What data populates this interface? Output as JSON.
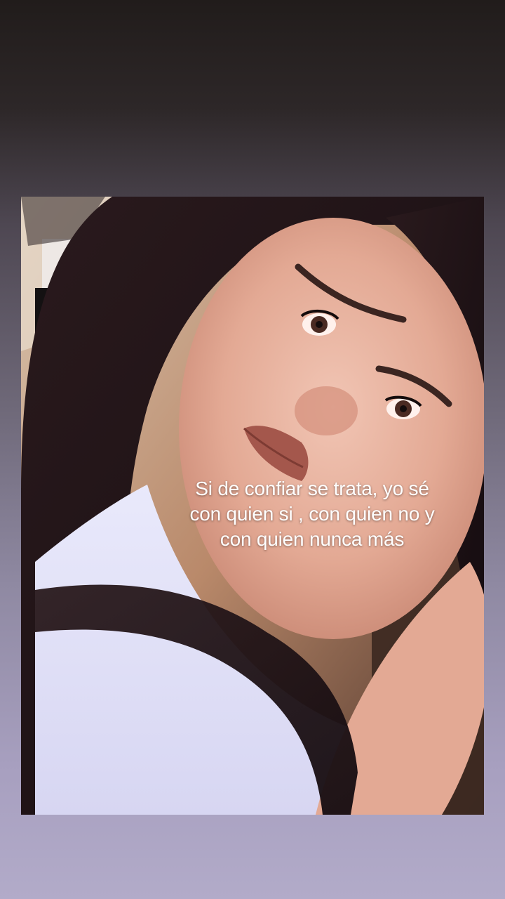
{
  "story": {
    "caption_lines": [
      "Si de confiar se trata, yo sé",
      "con quien si , con quien no y",
      "con quien nunca más"
    ],
    "photo_subject": "selfie-photo",
    "colors": {
      "background_top": "#211c1b",
      "background_bottom": "#b2abc9",
      "caption_text": "#ffffff"
    }
  }
}
